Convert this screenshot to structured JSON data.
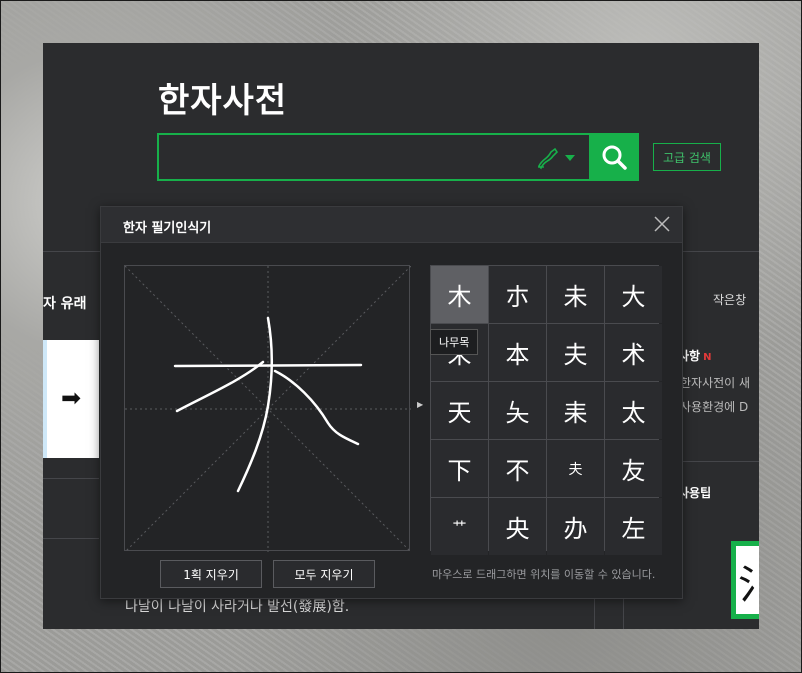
{
  "app": {
    "title": "한자사전",
    "search": {
      "value": "",
      "placeholder": ""
    },
    "advanced_search_label": "고급 검색",
    "left_tab_label": "자 유래",
    "arrow_card_glyph": "➡",
    "bottom_text": "나날이 나날이 사라거나 발선(發展)함.",
    "right_panel": {
      "window_size_label": "작은창",
      "notice_title": "사항",
      "notice_new_badge": "N",
      "notice_line1": "한자사전이 새",
      "notice_line2": "사용환경에 D",
      "tips_title": "사용팁",
      "image_glyph": "氵"
    }
  },
  "handwriting_modal": {
    "title": "한자 필기인식기",
    "tooltip": "나무목",
    "candidates": [
      "木",
      "朩",
      "未",
      "大",
      "未",
      "本",
      "夫",
      "术",
      "天",
      "夨",
      "耒",
      "太",
      "下",
      "不",
      "夫",
      "友",
      "艹",
      "央",
      "办",
      "左"
    ],
    "selected_index": 0,
    "clear_one_label": "1획 지우기",
    "clear_all_label": "모두 지우기",
    "hint": "마우스로 드래그하면 위치를 이동할 수 있습니다."
  },
  "colors": {
    "accent": "#17b04a",
    "panel_bg": "#2b2c2e",
    "modal_bg": "#232426",
    "new_badge": "#e23a3a"
  }
}
